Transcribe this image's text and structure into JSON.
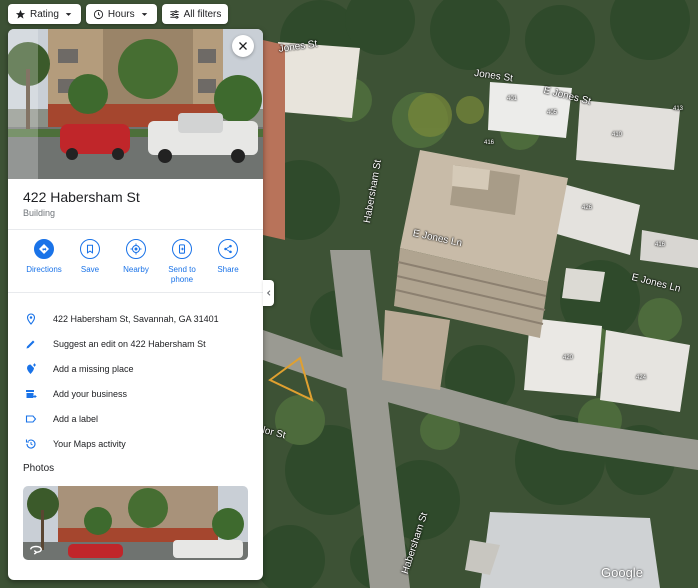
{
  "filters": {
    "rating": "Rating",
    "hours": "Hours",
    "all_filters": "All filters"
  },
  "place": {
    "name": "422 Habersham St",
    "category": "Building"
  },
  "actions": [
    {
      "label": "Directions",
      "icon": "directions-icon"
    },
    {
      "label": "Save",
      "icon": "bookmark-icon"
    },
    {
      "label": "Nearby",
      "icon": "nearby-icon"
    },
    {
      "label": "Send to phone",
      "icon": "phone-icon"
    },
    {
      "label": "Share",
      "icon": "share-icon"
    }
  ],
  "rows": [
    {
      "text": "422 Habersham St, Savannah, GA 31401",
      "icon": "location-pin-icon"
    },
    {
      "text": "Suggest an edit on 422 Habersham St",
      "icon": "pencil-icon"
    },
    {
      "text": "Add a missing place",
      "icon": "add-place-icon"
    },
    {
      "text": "Add your business",
      "icon": "add-business-icon"
    },
    {
      "text": "Add a label",
      "icon": "label-icon"
    },
    {
      "text": "Your Maps activity",
      "icon": "history-icon"
    }
  ],
  "photos_heading": "Photos",
  "map": {
    "streets": {
      "jones_st_1": "Jones St",
      "jones_st_2": "Jones St",
      "e_jones_st": "E Jones St",
      "habersham_st_1": "Habersham St",
      "habersham_st_2": "Habersham St",
      "e_jones_ln_1": "E Jones Ln",
      "e_jones_ln_2": "E Jones Ln",
      "taylor_st": "lor St"
    },
    "building_numbers": [
      "401",
      "405",
      "410",
      "413",
      "416",
      "426",
      "420",
      "424",
      "416"
    ],
    "attribution": "Google"
  },
  "colors": {
    "accent": "#1a73e8",
    "icon": "#1a73e8"
  }
}
